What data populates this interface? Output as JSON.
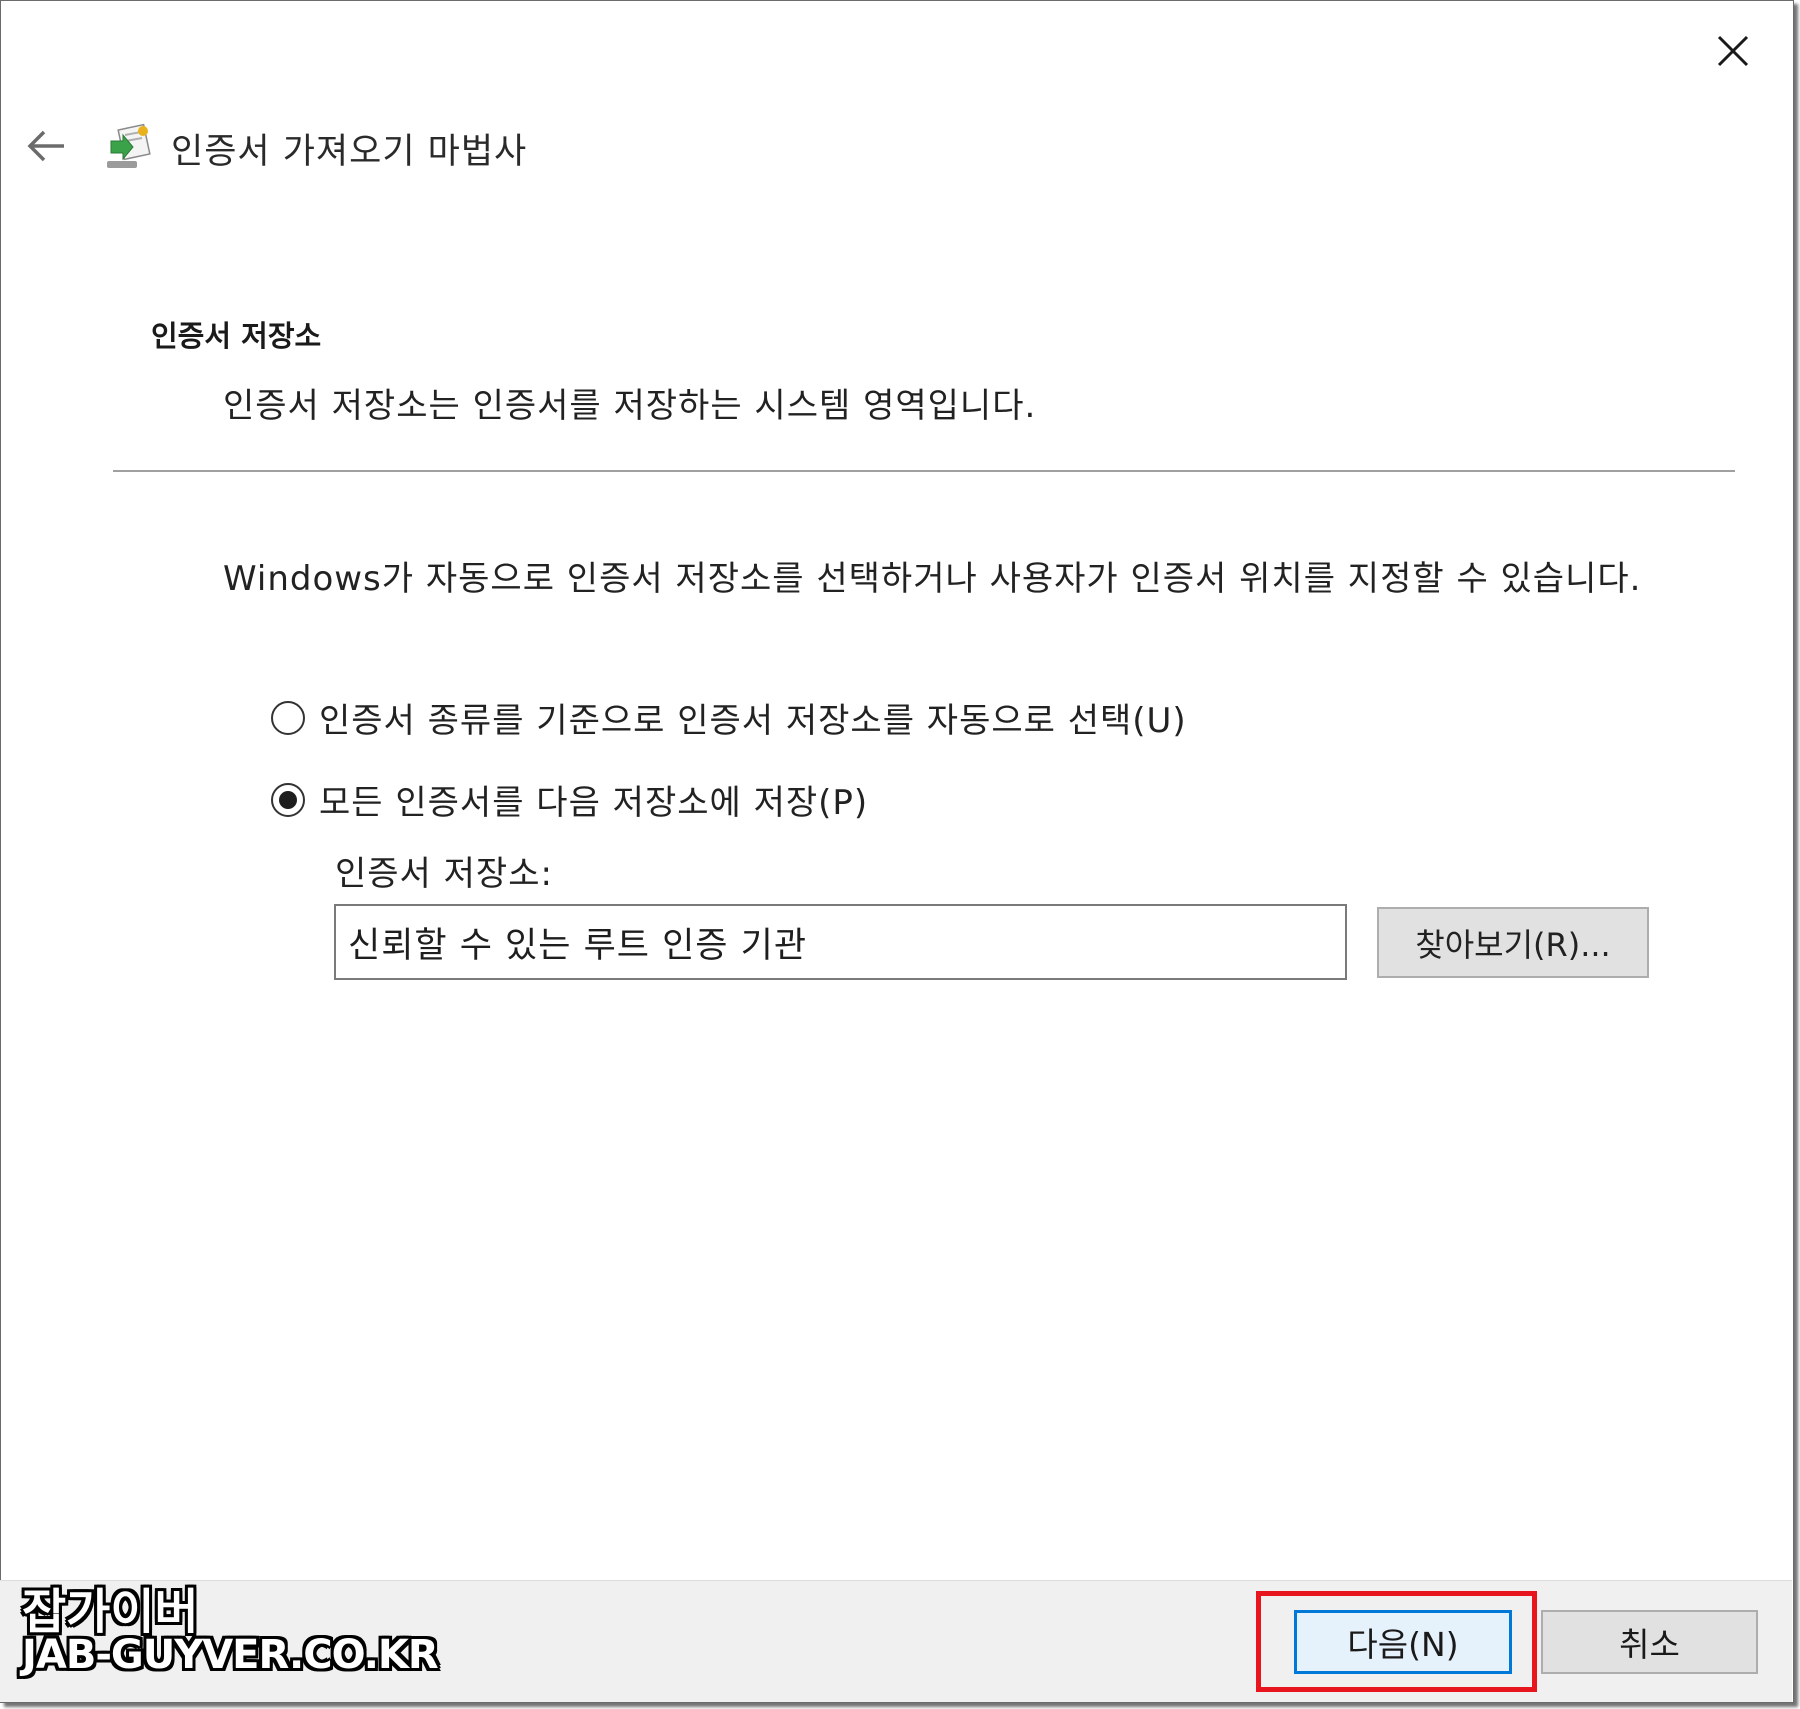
{
  "window": {
    "title": "인증서 가져오기 마법사",
    "back_icon": "arrow-left-icon",
    "close_icon": "close-icon",
    "wizard_icon": "certificate-import-icon"
  },
  "page": {
    "heading": "인증서 저장소",
    "description": "인증서 저장소는 인증서를 저장하는 시스템 영역입니다.",
    "intro": "Windows가 자동으로 인증서 저장소를 선택하거나 사용자가 인증서 위치를 지정할 수 있습니다."
  },
  "options": [
    {
      "label": "인증서 종류를 기준으로 인증서 저장소를 자동으로 선택(U)",
      "selected": false
    },
    {
      "label": "모든 인증서를 다음 저장소에 저장(P)",
      "selected": true
    }
  ],
  "store": {
    "label": "인증서 저장소:",
    "value": "신뢰할 수 있는 루트 인증 기관",
    "browse_label": "찾아보기(R)..."
  },
  "footer": {
    "next_label": "다음(N)",
    "cancel_label": "취소"
  },
  "watermark": {
    "line1": "잡가이버",
    "line2": "JAB-GUYVER.CO.KR"
  },
  "colors": {
    "accent": "#0078d7",
    "highlight": "#e8141e",
    "footer_bg": "#f0f0f0"
  }
}
